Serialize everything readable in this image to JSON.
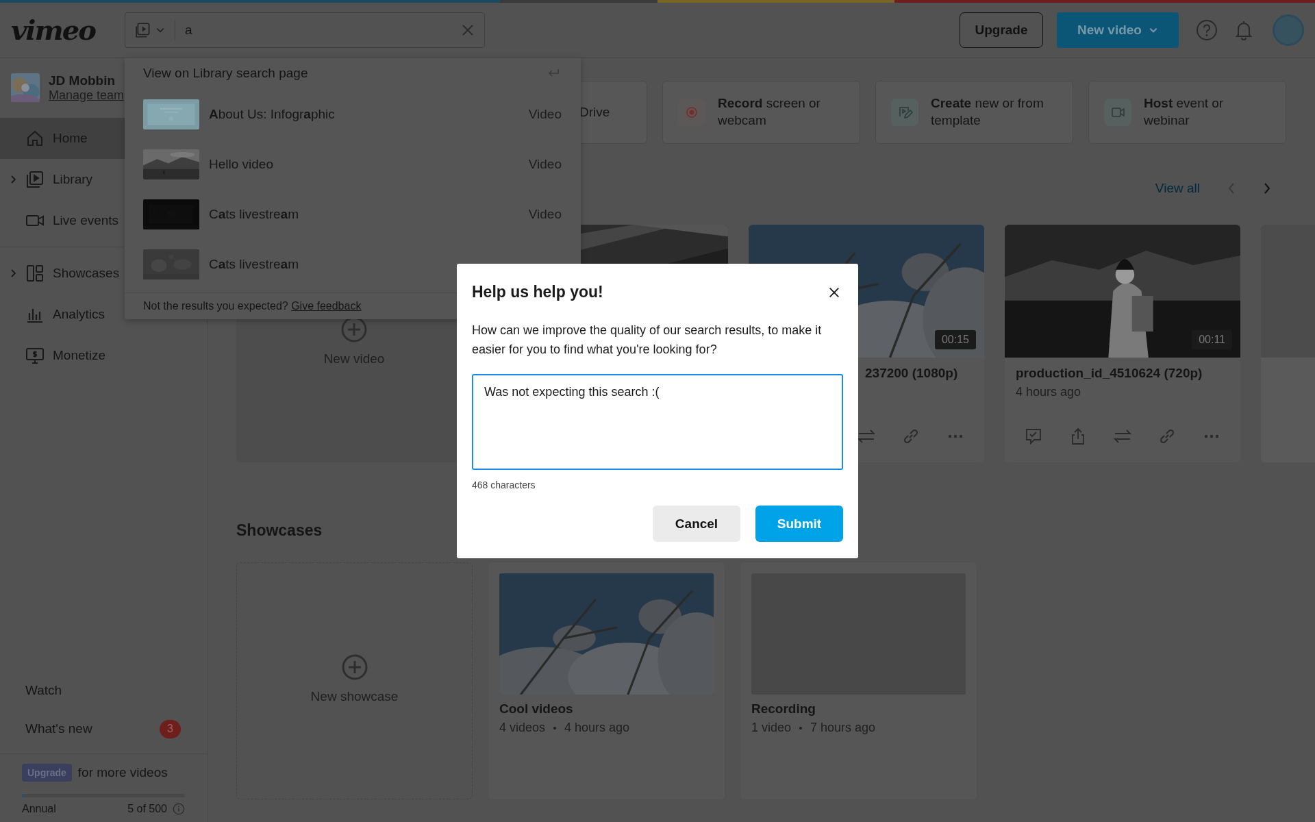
{
  "header": {
    "logo": "vimeo",
    "search": {
      "value": "a"
    },
    "upgrade": "Upgrade",
    "new_video": "New video"
  },
  "sidebar": {
    "user": {
      "name": "JD Mobbin",
      "link": "Manage team"
    },
    "nav_groups": [
      [
        {
          "kind": "home",
          "label": "Home",
          "selected": true,
          "expandable": false
        },
        {
          "kind": "library",
          "label": "Library",
          "selected": false,
          "expandable": true
        },
        {
          "kind": "live",
          "label": "Live events",
          "selected": false,
          "expandable": false
        }
      ],
      [
        {
          "kind": "showcases",
          "label": "Showcases",
          "selected": false,
          "expandable": true
        },
        {
          "kind": "analytics",
          "label": "Analytics",
          "selected": false,
          "expandable": false
        },
        {
          "kind": "monetize",
          "label": "Monetize",
          "selected": false,
          "expandable": false
        }
      ]
    ],
    "links": [
      {
        "label": "Watch"
      },
      {
        "label": "What's new",
        "badge": "3"
      }
    ],
    "plan": {
      "badge": "Upgrade",
      "text": "for more videos",
      "level": 0.01,
      "period": "Annual",
      "usage": "5 of 500"
    }
  },
  "search_dropdown": {
    "view_all": "View on Library search page",
    "results": [
      {
        "title": "**A**bout Us: Infogr**a**phic",
        "type": "Video"
      },
      {
        "title": "Hello video",
        "type": "Video"
      },
      {
        "title": "C**a**ts livestre**a**m",
        "type": "Video"
      },
      {
        "title": "C**a**ts livestre**a**m"
      }
    ],
    "footer": {
      "text": "Not the results you expected?",
      "link": "Give feedback"
    }
  },
  "quick_actions": [
    {
      "kind": "covered",
      "text": "Drive"
    },
    {
      "kind": "record",
      "text": "**Record** screen or webcam"
    },
    {
      "kind": "create",
      "text": "**Create** new or from template"
    },
    {
      "kind": "host",
      "text": "**Host** event or webinar"
    }
  ],
  "recent": {
    "view_all": "View all",
    "prev_disabled": true,
    "cards": [
      {
        "kind": "new",
        "label": "New video"
      },
      {
        "kind": "picture"
      },
      {
        "kind": "covered",
        "duration": "00:15",
        "title": "237200 (1080p)"
      },
      {
        "kind": "video",
        "duration": "00:11",
        "title": "production_id_4510624 (720p)",
        "meta": "4 hours ago"
      },
      {
        "kind": "edge"
      }
    ]
  },
  "showcases": {
    "title": "Showcases",
    "cards": [
      {
        "kind": "new",
        "label": "New showcase"
      },
      {
        "title": "Cool videos",
        "count": "4 videos",
        "time": "4 hours ago"
      },
      {
        "kind": "empty",
        "title": "Recording",
        "count": "1 video",
        "time": "7 hours ago"
      }
    ]
  },
  "modal": {
    "title": "Help us help you!",
    "text": "How can we improve the quality of our search results, to make it easier for you to find what you're looking for?",
    "value": "Was not expecting this search :(",
    "counter": "468 characters",
    "cancel": "Cancel",
    "submit": "Submit"
  }
}
